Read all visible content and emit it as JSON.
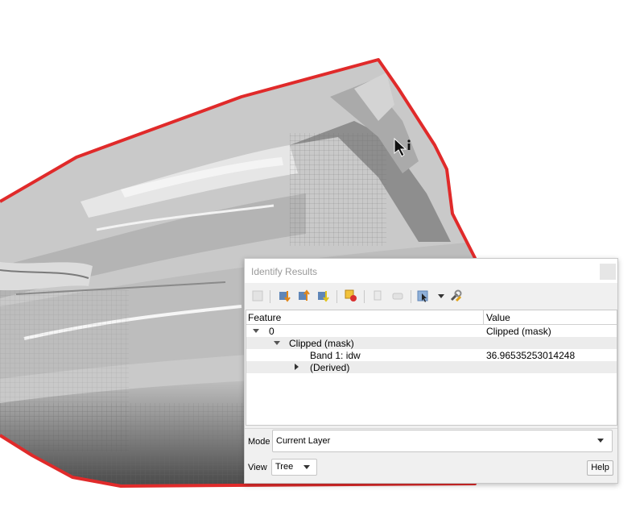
{
  "dialog": {
    "title": "Identify Results",
    "toolbar_icons": [
      "expand-icon",
      "expand-all-icon",
      "collapse-all-icon",
      "expand-new-icon",
      "clear-results-icon",
      "copy-icon",
      "print-icon",
      "select-features-icon",
      "dropdown-icon",
      "settings-icon"
    ]
  },
  "tree": {
    "headers": {
      "feature": "Feature",
      "value": "Value"
    },
    "rows": [
      {
        "feature": "0",
        "value": "Clipped (mask)"
      },
      {
        "feature": "Clipped (mask)",
        "value": ""
      },
      {
        "feature": "Band 1: idw",
        "value": "36.96535253014248"
      },
      {
        "feature": "(Derived)",
        "value": ""
      }
    ]
  },
  "mode": {
    "label": "Mode",
    "value": "Current Layer"
  },
  "view": {
    "label": "View",
    "value": "Tree"
  },
  "help_label": "Help",
  "colors": {
    "boundary": "#e02a2a",
    "dialog_bg": "#f0f0f0"
  }
}
